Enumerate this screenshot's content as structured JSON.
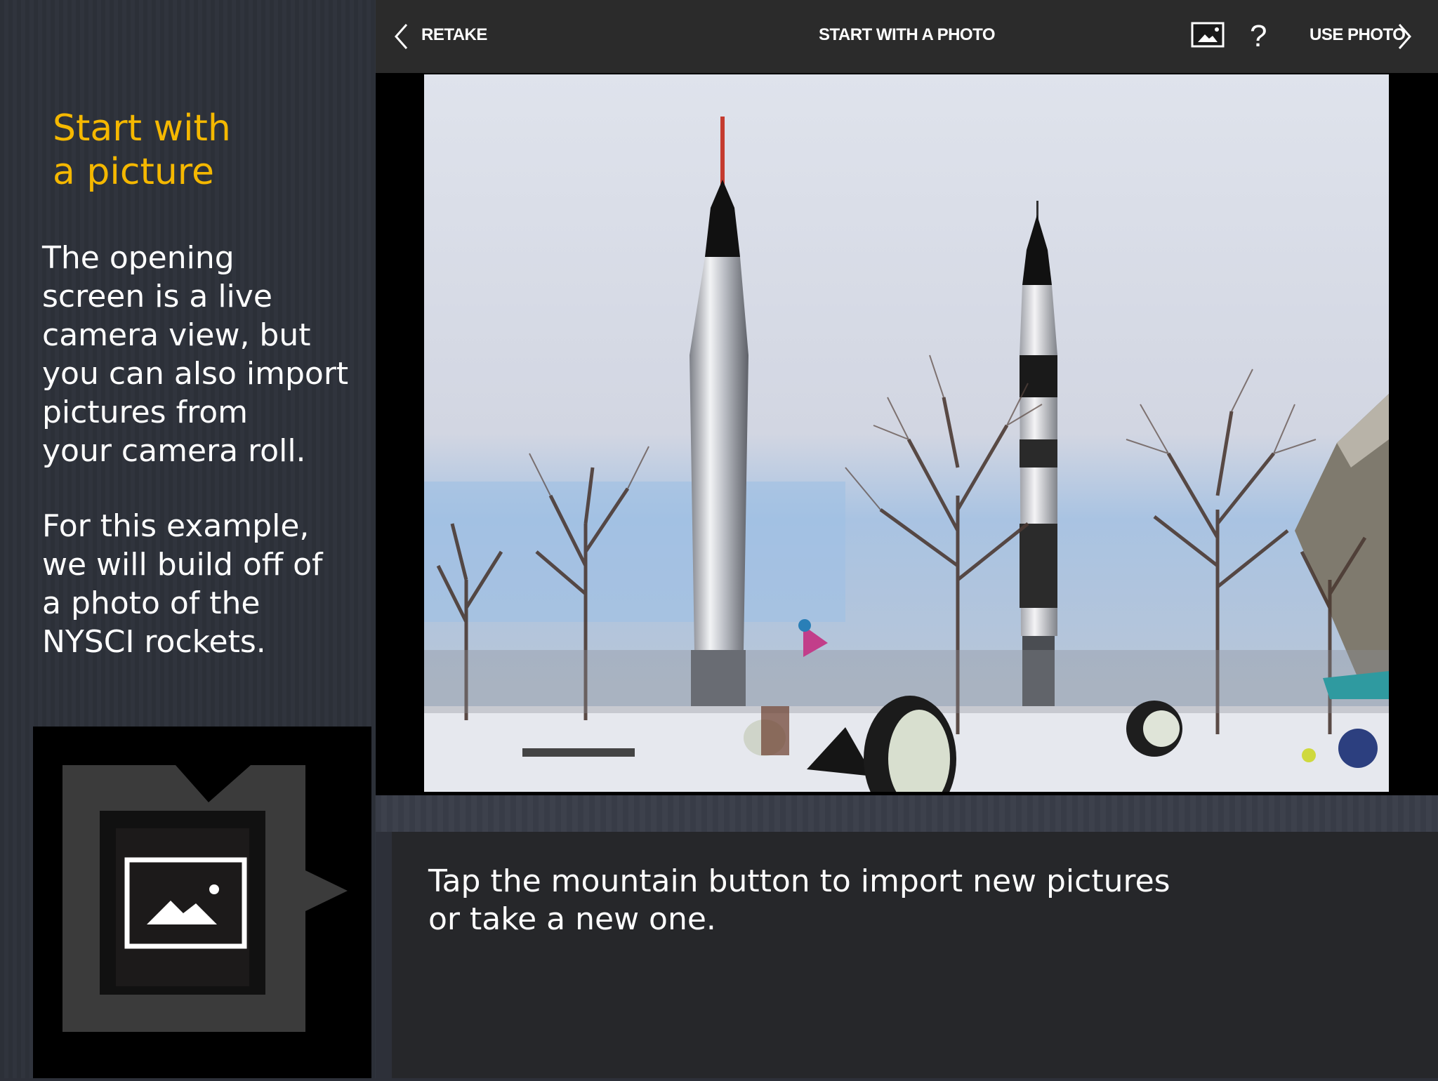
{
  "slide": {
    "title_line1": "Start with",
    "title_line2": "a picture",
    "paragraph1": [
      "The opening",
      "screen is a live",
      "camera view, but",
      "you can also import",
      "pictures from",
      "your camera roll."
    ],
    "paragraph2": [
      "For this example,",
      "we will build off of",
      "a photo of the",
      "NYSCI rockets."
    ],
    "caption": [
      "Tap the mountain button to import new pictures",
      "or take a new one."
    ],
    "large_icon": "mountain-photo-icon"
  },
  "app": {
    "toolbar": {
      "retake_label": "RETAKE",
      "title": "START WITH A PHOTO",
      "use_photo_label": "USE PHOTO",
      "help_glyph": "?",
      "icons": [
        "chevron-left-icon",
        "mountain-photo-icon",
        "help-icon",
        "chevron-right-icon"
      ]
    },
    "photo_subject": "NYSCI rockets"
  },
  "colors": {
    "title": "#f5b800",
    "panel_bg": "#2d3039",
    "toolbar_bg": "#2b2b2b",
    "caption_bg": "#26272a"
  }
}
